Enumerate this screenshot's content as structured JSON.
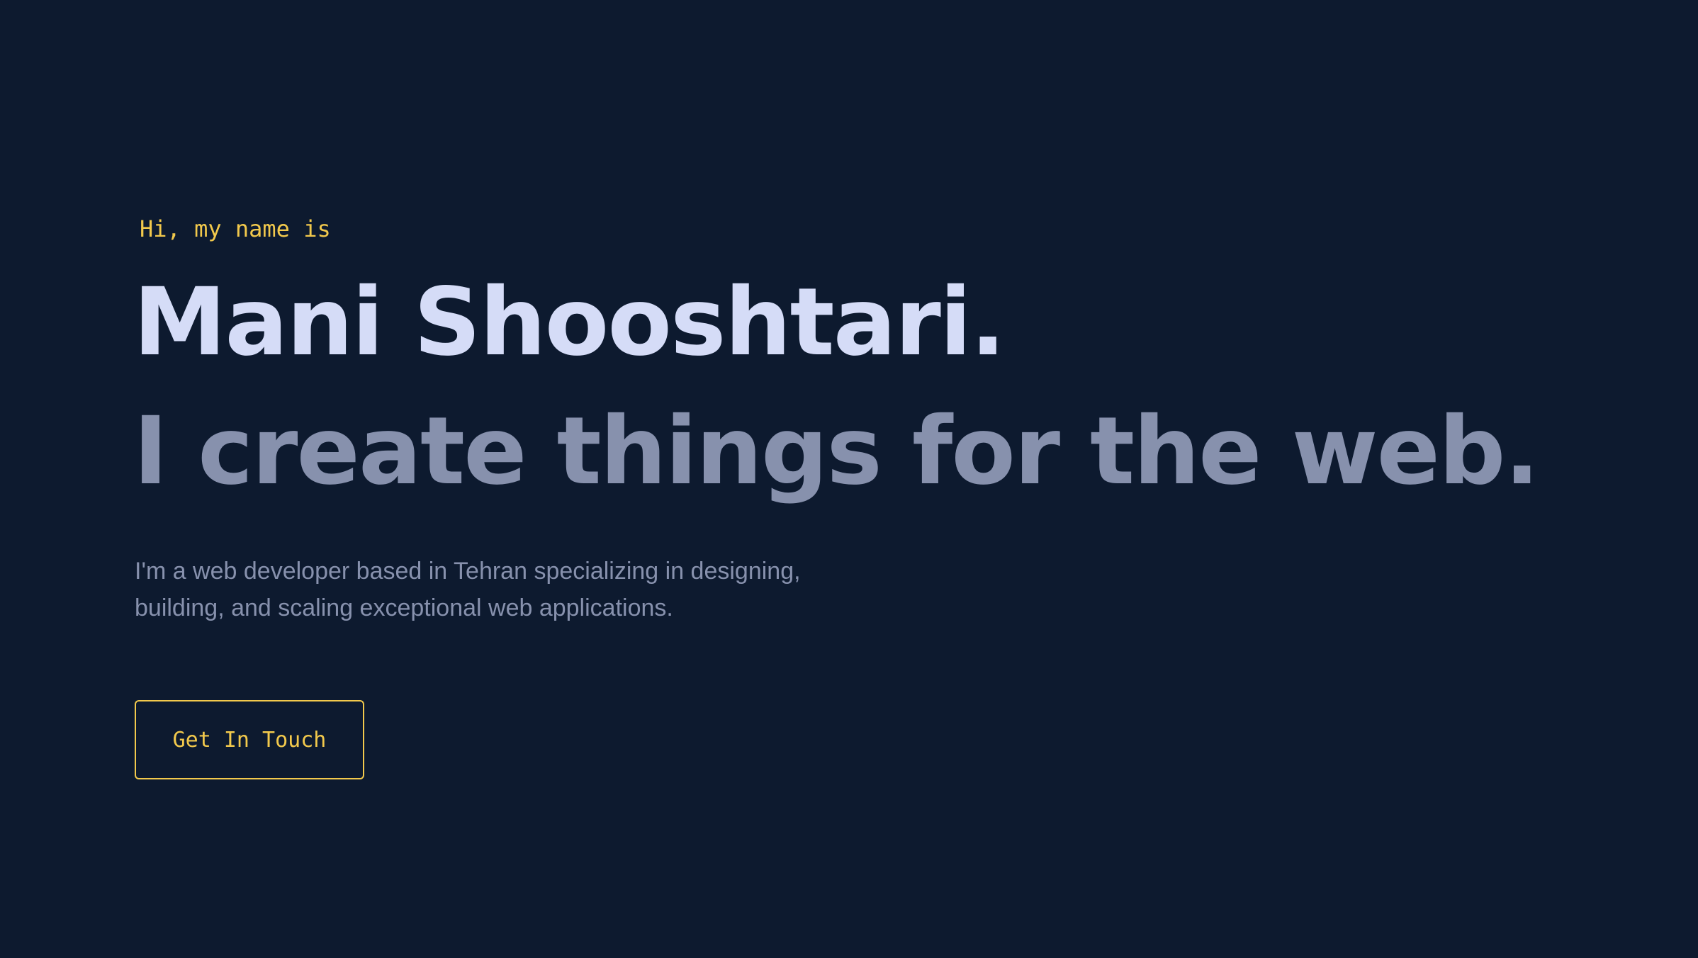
{
  "hero": {
    "greeting": "Hi, my name is",
    "name": "Mani Shooshtari.",
    "tagline": "I create things for the web.",
    "intro": "I'm a web developer based in Tehran specializing in designing, building, and scaling exceptional web applications.",
    "cta_label": "Get In Touch"
  },
  "colors": {
    "background": "#0d1a2f",
    "accent": "#f2c94c",
    "name": "#d5dcf7",
    "muted": "#8791ad"
  }
}
